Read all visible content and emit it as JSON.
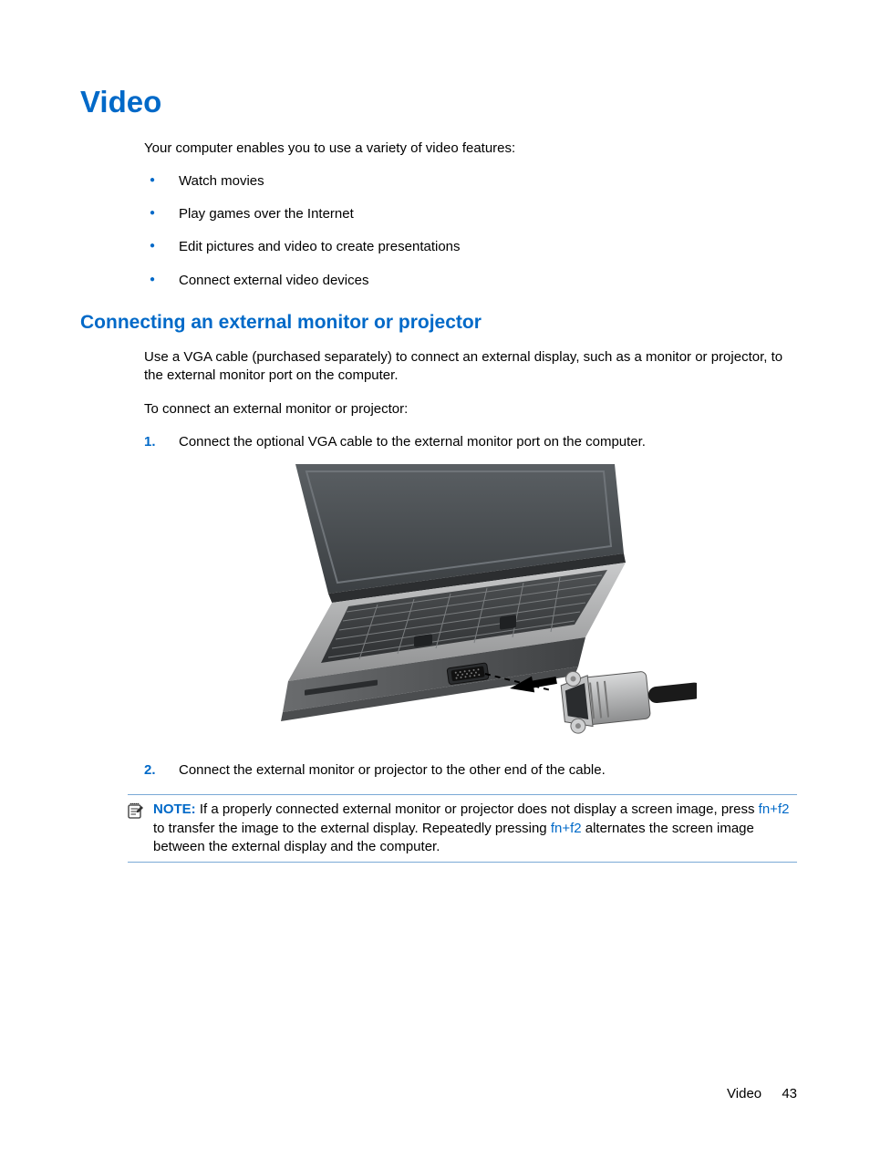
{
  "heading": "Video",
  "intro": "Your computer enables you to use a variety of video features:",
  "features": [
    "Watch movies",
    "Play games over the Internet",
    "Edit pictures and video to create presentations",
    "Connect external video devices"
  ],
  "subheading": "Connecting an external monitor or projector",
  "sub_para1": "Use a VGA cable (purchased separately) to connect an external display, such as a monitor or projector, to the external monitor port on the computer.",
  "sub_para2": "To connect an external monitor or projector:",
  "steps": [
    {
      "num": "1.",
      "text": "Connect the optional VGA cable to the external monitor port on the computer."
    },
    {
      "num": "2.",
      "text": "Connect the external monitor or projector to the other end of the cable."
    }
  ],
  "note": {
    "label": "NOTE:",
    "part1": "If a properly connected external monitor or projector does not display a screen image, press ",
    "key1": "fn+f2",
    "part2": " to transfer the image to the external display. Repeatedly pressing ",
    "key2": "fn+f2",
    "part3": " alternates the screen image between the external display and the computer."
  },
  "footer": {
    "section": "Video",
    "page": "43"
  }
}
